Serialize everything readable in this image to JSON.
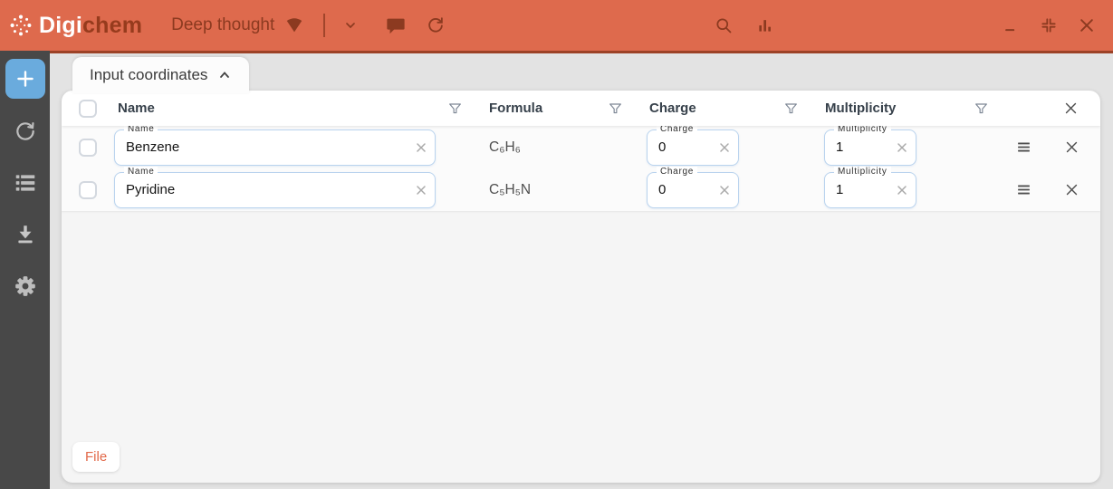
{
  "app": {
    "logo_part1": "Digi",
    "logo_part2": "chem",
    "project_name": "Deep thought"
  },
  "tab": {
    "label": "Input coordinates"
  },
  "table": {
    "headers": {
      "name": "Name",
      "formula": "Formula",
      "charge": "Charge",
      "multiplicity": "Multiplicity"
    },
    "field_labels": {
      "name": "Name",
      "charge": "Charge",
      "multiplicity": "Multiplicity"
    },
    "rows": [
      {
        "name": "Benzene",
        "formula": "C₆H₆",
        "charge": "0",
        "multiplicity": "1"
      },
      {
        "name": "Pyridine",
        "formula": "C₅H₅N",
        "charge": "0",
        "multiplicity": "1"
      }
    ]
  },
  "footer": {
    "file_button_label": "File"
  },
  "icons": {
    "header": [
      "molecule-burst-logo",
      "fan-indicator",
      "chevron-down",
      "chat-bubble",
      "sync",
      "search",
      "bar-chart",
      "minimize",
      "compress-window",
      "close-window"
    ],
    "sidebar": [
      "plus-add",
      "refresh-cycle",
      "queue-list",
      "download",
      "gear-settings"
    ],
    "table": [
      "filter-funnel",
      "checkbox",
      "clear-x",
      "row-menu",
      "row-delete",
      "close-table",
      "chevron-up"
    ]
  },
  "colors": {
    "header_bg": "#DE6A4D",
    "header_dark_accent": "#8C3A20",
    "header_underline": "#9C4227",
    "sidebar_bg": "#484848",
    "primary_blue": "#6AABDD",
    "input_border": "#B9D3EE",
    "page_bg": "#E3E3E3",
    "panel_bg": "#F5F5F5",
    "table_header_text": "#37414B",
    "file_button_text": "#E2694A"
  }
}
